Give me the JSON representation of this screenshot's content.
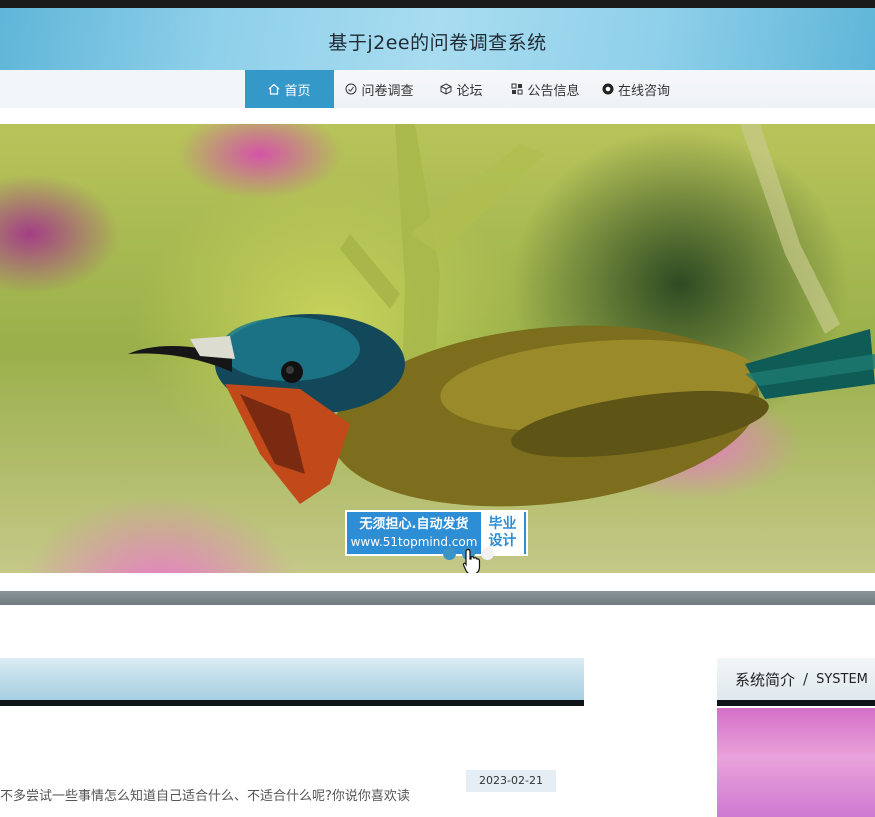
{
  "header": {
    "title": "基于j2ee的问卷调查系统"
  },
  "nav": {
    "items": [
      {
        "label": "首页",
        "icon": "home-icon",
        "active": true
      },
      {
        "label": "问卷调查",
        "icon": "survey-icon",
        "active": false
      },
      {
        "label": "论坛",
        "icon": "cube-icon",
        "active": false
      },
      {
        "label": "公告信息",
        "icon": "grid-icon",
        "active": false
      },
      {
        "label": "在线咨询",
        "icon": "chat-icon",
        "active": false
      }
    ]
  },
  "banner": {
    "watermark": {
      "line1": "无须担心.自动发货",
      "line2": "www.51topmind.com",
      "badge_line1": "毕业",
      "badge_line2": "设计"
    },
    "carousel": {
      "total": 3,
      "active_index": 0
    }
  },
  "sidebar_panel": {
    "title_cn": "系统简介",
    "separator": "/",
    "title_en": "SYSTEM"
  },
  "main_panel": {
    "date": "2023-02-21",
    "excerpt": "不多尝试一些事情怎么知道自己适合什么、不适合什么呢?你说你喜欢读"
  },
  "colors": {
    "accent": "#3498c9",
    "header_bg": "#8fd0ea",
    "watermark_bg": "#2d8ed6"
  }
}
